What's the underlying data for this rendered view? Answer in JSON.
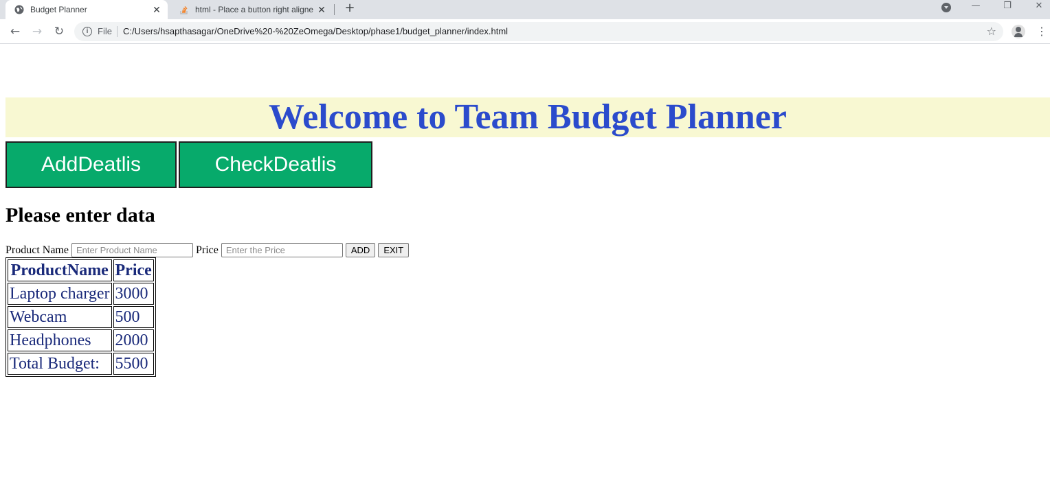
{
  "browser": {
    "tabs": [
      {
        "title": "Budget Planner",
        "active": true,
        "icon": "globe-icon"
      },
      {
        "title": "html - Place a button right aligne",
        "active": false,
        "icon": "stackoverflow-icon"
      }
    ],
    "address": {
      "scheme_label": "File",
      "url": "C:/Users/hsapthasagar/OneDrive%20-%20ZeOmega/Desktop/phase1/budget_planner/index.html"
    }
  },
  "page": {
    "banner_title": "Welcome to Team Budget Planner",
    "buttons": {
      "add_details": "AddDeatlis",
      "check_details": "CheckDeatlis"
    },
    "section_heading": "Please enter data",
    "form": {
      "product_label": "Product Name",
      "product_placeholder": "Enter Product Name",
      "price_label": "Price",
      "price_placeholder": "Enter the Price",
      "add_label": "ADD",
      "exit_label": "EXIT"
    },
    "table": {
      "headers": [
        "ProductName",
        "Price"
      ],
      "rows": [
        [
          "Laptop charger",
          "3000"
        ],
        [
          "Webcam",
          "500"
        ],
        [
          "Headphones",
          "2000"
        ]
      ],
      "total_label": "Total Budget:",
      "total_value": "5500"
    },
    "colors": {
      "banner_bg": "#f8f8d2",
      "banner_text": "#2b4bcc",
      "button_bg": "#07aa6b",
      "table_text": "#1a2a7a"
    }
  }
}
